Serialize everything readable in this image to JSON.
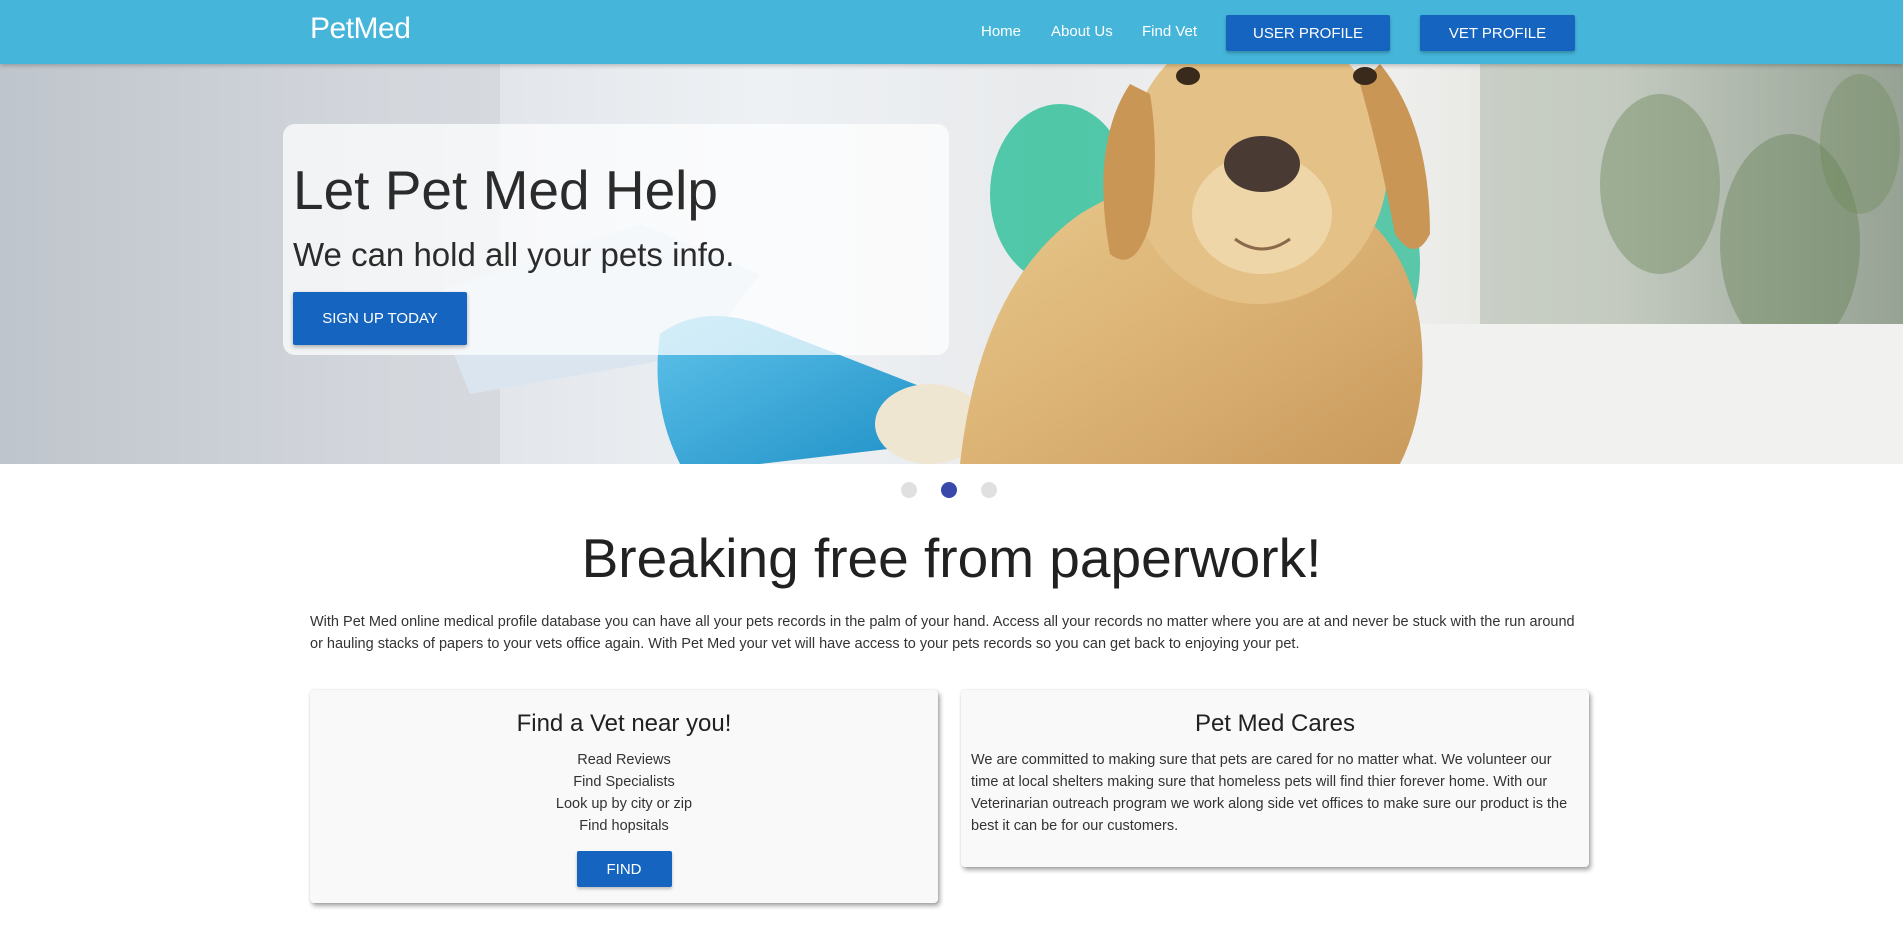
{
  "navbar": {
    "brand": "PetMed",
    "links": [
      "Home",
      "About Us",
      "Find Vet"
    ],
    "user_profile_label": "USER PROFILE",
    "vet_profile_label": "VET PROFILE",
    "background_color": "#45b5da",
    "button_color": "#1565c0"
  },
  "hero": {
    "title": "Let Pet Med Help",
    "subtitle": "We can hold all your pets info.",
    "cta_label": "SIGN UP TODAY"
  },
  "carousel": {
    "slide_count": 3,
    "active_index": 1,
    "active_color": "#3949ab"
  },
  "main": {
    "heading": "Breaking free from paperwork!",
    "intro": "With Pet Med online medical profile database you can have all your pets records in the palm of your hand. Access all your records no matter where you are at and never be stuck with the run around or hauling stacks of papers to your vets office again. With Pet Med your vet will have access to your pets records so you can get back to enjoying your pet."
  },
  "cards": {
    "find_vet": {
      "title": "Find a Vet near you!",
      "items": [
        "Read Reviews",
        "Find Specialists",
        "Look up by city or zip",
        "Find hopsitals"
      ],
      "button_label": "FIND"
    },
    "cares": {
      "title": "Pet Med Cares",
      "text": "We are committed to making sure that pets are cared for no matter what. We volunteer our time at local shelters making sure that homeless pets will find thier forever home. With our Veterinarian outreach program we work along side vet offices to make sure our product is the best it can be for our customers."
    }
  }
}
